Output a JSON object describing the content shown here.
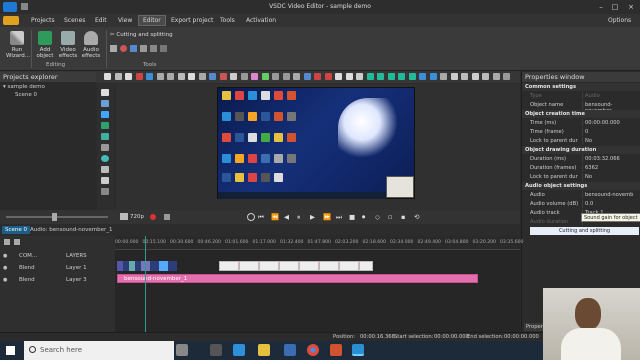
{
  "app": {
    "title": "VSDC Video Editor - sample demo",
    "options_label": "Options"
  },
  "menu": [
    "Projects",
    "Scenes",
    "Edit",
    "View",
    "Editor",
    "Export project",
    "Tools",
    "Activation"
  ],
  "ribbon": {
    "run_wizard": "Run\nWizard...",
    "add_object": "Add\nobject",
    "video_effects": "Video\neffects",
    "audio_effects": "Audio\neffects",
    "cutting_splitting": "Cutting and splitting",
    "group_editing": "Editing",
    "group_tools": "Tools"
  },
  "project_explorer": {
    "title": "Projects explorer",
    "items": [
      "sample demo",
      "Scene 0"
    ]
  },
  "properties": {
    "title": "Properties window",
    "rows": [
      {
        "type": "section",
        "key": "Common settings"
      },
      {
        "type": "row",
        "key": "Type",
        "val": "Audio",
        "dim": true
      },
      {
        "type": "row",
        "key": "Object name",
        "val": "bensound-november_"
      },
      {
        "type": "section",
        "key": "Object creation time"
      },
      {
        "type": "row",
        "key": "Time (ms)",
        "val": "00:00:00.000"
      },
      {
        "type": "row",
        "key": "Time (frame)",
        "val": "0"
      },
      {
        "type": "row",
        "key": "Lock to parent dur",
        "val": "No"
      },
      {
        "type": "section",
        "key": "Object drawing duration"
      },
      {
        "type": "row",
        "key": "Duration (ms)",
        "val": "00:03:32.066"
      },
      {
        "type": "row",
        "key": "Duration (frames)",
        "val": "6362"
      },
      {
        "type": "row",
        "key": "Lock to parent dur",
        "val": "No"
      },
      {
        "type": "section",
        "key": "Audio object settings"
      },
      {
        "type": "row",
        "key": "Audio",
        "val": "bensound-novemb"
      },
      {
        "type": "row",
        "key": "Audio volume (dB)",
        "val": "0.0"
      },
      {
        "type": "row",
        "key": "Audio track",
        "val": "Track 1"
      },
      {
        "type": "row",
        "key": "Audio duration",
        "val": "",
        "dim": true
      }
    ],
    "tooltip": "Sound gain for object",
    "cut_button": "Cutting and splitting",
    "bottom_tab": "Properties"
  },
  "playback": {
    "quality": "720p"
  },
  "timeline": {
    "tab_scene": "Scene 0",
    "tab_audio": "Audio: bensound-november_1",
    "ruler": [
      "00:00.000",
      "00:15.100",
      "00:30.600",
      "00:46.200",
      "01:01.600",
      "01:17.000",
      "01:32.400",
      "01:47.800",
      "02:03.200",
      "02:18.600",
      "02:34.000",
      "02:49.400",
      "03:04.800",
      "03:20.200",
      "03:35.600"
    ],
    "layers": [
      {
        "blend": "COM...",
        "name": "LAYERS"
      },
      {
        "blend": "Blend",
        "name": "Layer 1"
      },
      {
        "blend": "Blend",
        "name": "Layer 3"
      }
    ],
    "audio_clip": "bensound-november_1"
  },
  "status": {
    "position_label": "Position:",
    "position": "00:00:16.366",
    "start_label": "Start selection:",
    "start": "00:00:00.000",
    "end_label": "End selection:",
    "end": "00:00:00.000"
  },
  "taskbar": {
    "search_placeholder": "Search here"
  },
  "colors": {
    "accent": "#3fa7ff",
    "audio_clip": "#e46fae",
    "playhead": "#7fffd4"
  }
}
